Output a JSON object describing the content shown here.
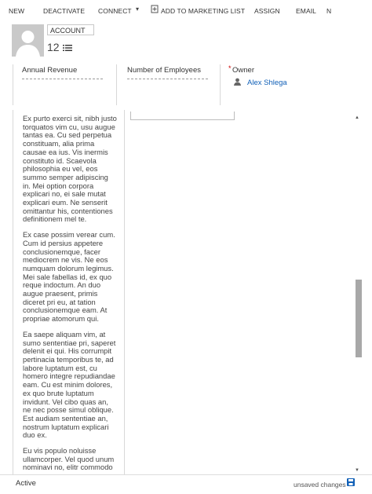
{
  "toolbar": {
    "new": "NEW",
    "deactivate": "DEACTIVATE",
    "connect": "CONNECT",
    "caret": "▾",
    "add_to_marketing_list": "ADD TO MARKETING LIST",
    "assign": "ASSIGN",
    "email": "EMAIL",
    "more": "N"
  },
  "header": {
    "entity_type": "ACCOUNT",
    "record_name": "12"
  },
  "header_fields": {
    "annual_revenue_label": "Annual Revenue",
    "employees_label": "Number of Employees",
    "owner_required_mark": "*",
    "owner_label": "Owner",
    "owner_value": "Alex Shlega"
  },
  "body": {
    "paragraphs": [
      "Ex purto exerci sit, nibh justo torquatos vim cu, usu augue tantas ea. Cu sed perpetua constituam, alia prima causae ea ius. Vis inermis constituto id. Scaevola philosophia eu vel, eos summo semper adipiscing in. Mei option corpora explicari no, ei sale mutat explicari eum. Ne senserit omittantur his, contentiones definitionem mel te.",
      "Ex case possim verear cum. Cum id persius appetere conclusionemque, facer mediocrem ne vis. Ne eos numquam dolorum legimus. Mei sale fabellas id, ex quo reque indoctum. An duo augue praesent, primis diceret pri eu, at tation conclusionemque eam. At propriae atomorum qui.",
      "Ea saepe aliquam vim, at sumo sententiae pri, saperet delenit ei qui. His corrumpit pertinacia temporibus te, ad labore luptatum est, cu homero integre repudiandae eam. Cu est minim dolores, ex quo brute luptatum invidunt. Vel cibo quas an, ne nec posse simul oblique. Est audiam sententiae an, nostrum luptatum explicari duo ex.",
      "Eu vis populo noluisse ullamcorper. Vel quod unum nominavi no, elitr commodo"
    ]
  },
  "footer": {
    "status": "Active",
    "unsaved": "unsaved changes"
  },
  "colors": {
    "link": "#1160b7",
    "required": "#cc0000",
    "save_icon": "#1160b7"
  }
}
